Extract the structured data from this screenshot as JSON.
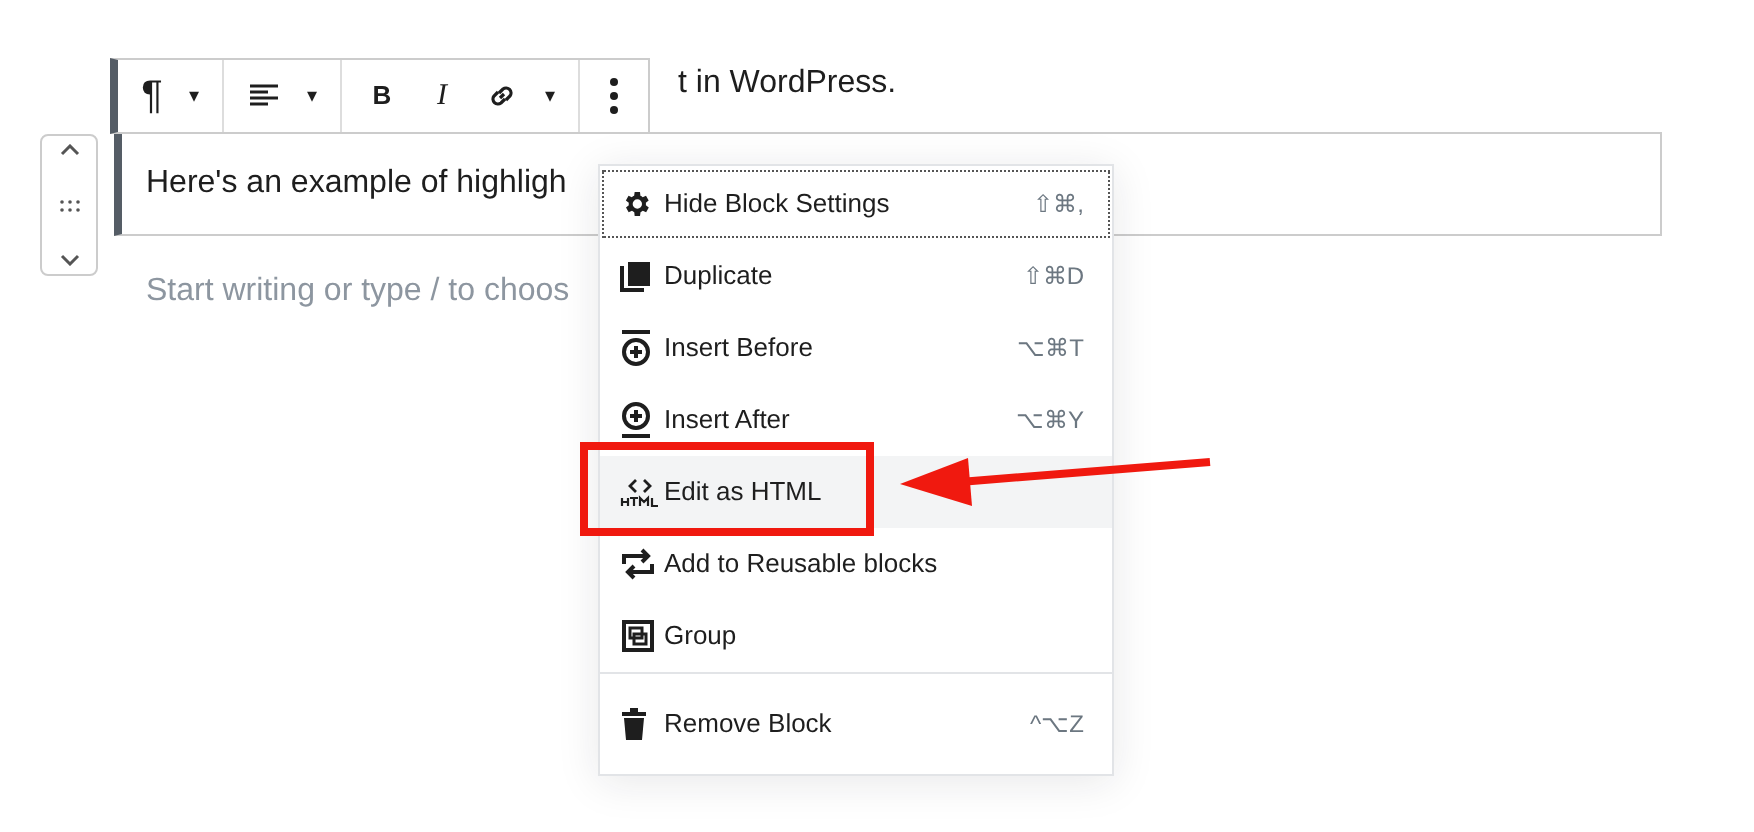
{
  "heading_fragment": "t in WordPress.",
  "paragraph": "Here's an example of highligh",
  "placeholder": "Start writing or type / to choos",
  "toolbar": {
    "groups": [
      [
        {
          "kind": "text",
          "text": "¶"
        },
        {
          "kind": "text",
          "text": "▾"
        }
      ],
      [
        {
          "kind": "align"
        },
        {
          "kind": "text",
          "text": "▾"
        }
      ],
      [
        {
          "kind": "bold",
          "text": "B"
        },
        {
          "kind": "italic",
          "text": "I"
        },
        {
          "kind": "link"
        },
        {
          "kind": "text",
          "text": "▾"
        }
      ],
      [
        {
          "kind": "more"
        }
      ]
    ]
  },
  "menu": {
    "sections": [
      [
        {
          "label": "Hide Block Settings",
          "shortcut": "⇧⌘,",
          "highlighted": false,
          "focused": true
        },
        {
          "label": "Duplicate",
          "shortcut": "⇧⌘D",
          "highlighted": false,
          "focused": false
        },
        {
          "label": "Insert Before",
          "shortcut": "⌥⌘T",
          "highlighted": false,
          "focused": false
        },
        {
          "label": "Insert After",
          "shortcut": "⌥⌘Y",
          "highlighted": false,
          "focused": false
        },
        {
          "label": "Edit as HTML",
          "highlighted": true,
          "focused": false
        },
        {
          "label": "Add to Reusable blocks",
          "highlighted": false,
          "focused": false
        },
        {
          "label": "Group",
          "highlighted": false,
          "focused": false
        }
      ],
      [
        {
          "label": "Remove Block",
          "shortcut": "^⌥Z",
          "highlighted": false,
          "focused": false
        }
      ]
    ]
  }
}
